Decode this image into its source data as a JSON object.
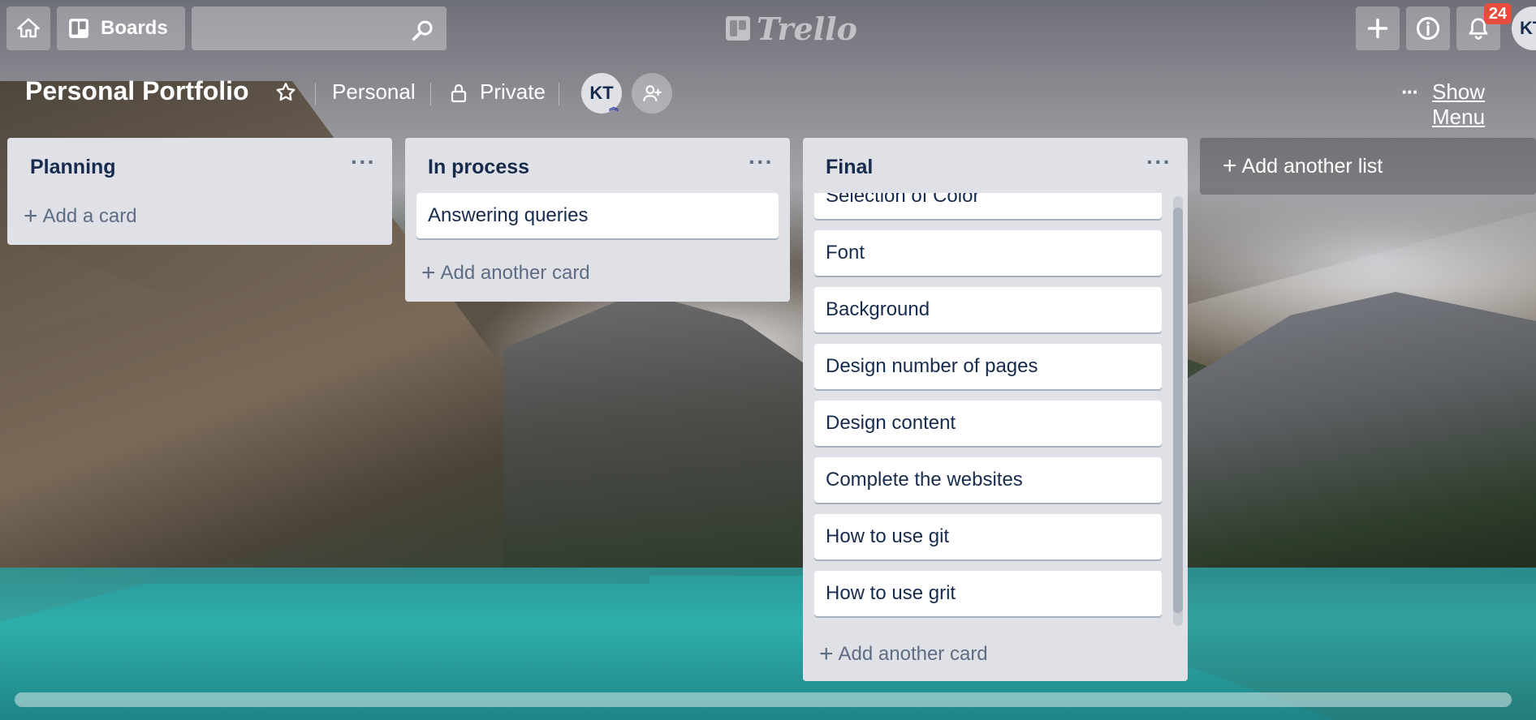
{
  "topbar": {
    "boards_label": "Boards",
    "search_placeholder": "",
    "logo_text": "Trello",
    "notifications_count": "24",
    "user_initials": "KT"
  },
  "board": {
    "title": "Personal Portfolio",
    "team_label": "Personal",
    "visibility_label": "Private",
    "member_initials": "KT",
    "more_glyph": "···",
    "show_menu_label": "Show Menu"
  },
  "lists": [
    {
      "title": "Planning",
      "cards": [],
      "add_label": "Add a card"
    },
    {
      "title": "In process",
      "cards": [
        "Answering queries"
      ],
      "add_label": "Add another card"
    },
    {
      "title": "Final",
      "cards": [
        "Selection of Color",
        "Font",
        "Background",
        "Design number of pages",
        "Design content",
        "Complete the websites",
        "How to use git",
        "How to use grit"
      ],
      "add_label": "Add another card"
    }
  ],
  "add_list_label": "Add another list",
  "list_more_glyph": "···"
}
